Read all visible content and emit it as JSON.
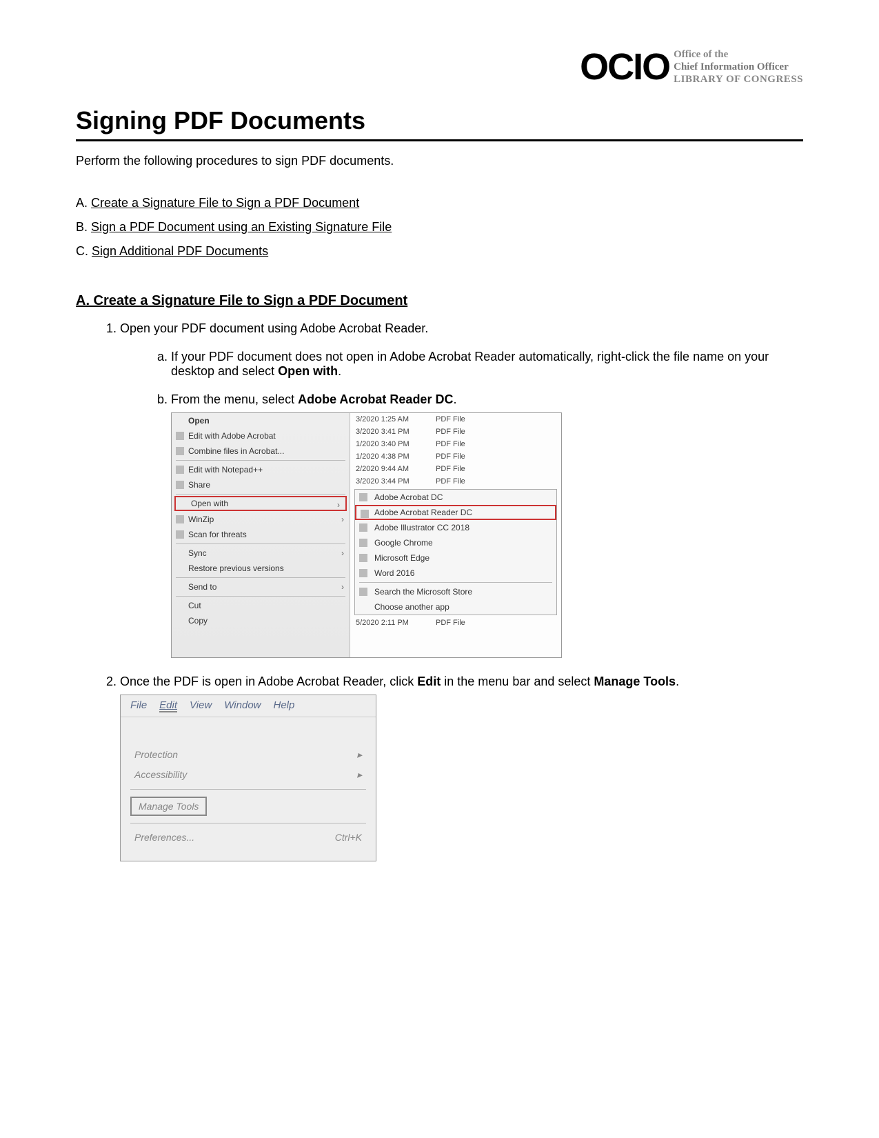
{
  "header": {
    "logo_text": "OCIO",
    "office_line1": "Office of the",
    "office_line2": "Chief Information Officer",
    "office_line3": "LIBRARY OF CONGRESS"
  },
  "title": "Signing PDF Documents",
  "intro": "Perform the following procedures to sign PDF documents.",
  "toc": {
    "a_prefix": "A. ",
    "a": "Create a Signature File to Sign a PDF Document",
    "b_prefix": "B. ",
    "b": "Sign a PDF Document using an Existing Signature File",
    "c_prefix": "C. ",
    "c": "Sign Additional PDF Documents"
  },
  "section_a": {
    "heading": "A. Create a Signature File to Sign a PDF Document",
    "step1": "Open your PDF document using Adobe Acrobat Reader.",
    "step1a_pre": "If your PDF document does not open in Adobe Acrobat Reader automatically, right-click the file name on your desktop and select ",
    "step1a_bold": "Open with",
    "step1a_post": ".",
    "step1b_pre": "From the menu, select ",
    "step1b_bold": "Adobe Acrobat Reader DC",
    "step1b_post": ".",
    "step2_pre": "Once the PDF is open in Adobe Acrobat Reader, click ",
    "step2_b1": "Edit",
    "step2_mid": " in the menu bar and select ",
    "step2_b2": "Manage Tools",
    "step2_post": "."
  },
  "screenshot1": {
    "ctx": {
      "open": "Open",
      "edit_acrobat": "Edit with Adobe Acrobat",
      "combine": "Combine files in Acrobat...",
      "edit_notepad": "Edit with Notepad++",
      "share": "Share",
      "open_with": "Open with",
      "winzip": "WinZip",
      "scan": "Scan for threats",
      "sync": "Sync",
      "restore": "Restore previous versions",
      "sendto": "Send to",
      "cut": "Cut",
      "copy": "Copy"
    },
    "files": [
      {
        "date": "3/2020 1:25 AM",
        "type": "PDF File"
      },
      {
        "date": "3/2020 3:41 PM",
        "type": "PDF File"
      },
      {
        "date": "1/2020 3:40 PM",
        "type": "PDF File"
      },
      {
        "date": "1/2020 4:38 PM",
        "type": "PDF File"
      },
      {
        "date": "2/2020 9:44 AM",
        "type": "PDF File"
      },
      {
        "date": "3/2020 3:44 PM",
        "type": "PDF File"
      }
    ],
    "submenu": {
      "acrobat_dc": "Adobe Acrobat DC",
      "reader_dc": "Adobe Acrobat Reader DC",
      "illustrator": "Adobe Illustrator CC 2018",
      "chrome": "Google Chrome",
      "edge": "Microsoft Edge",
      "word": "Word 2016",
      "store": "Search the Microsoft Store",
      "choose": "Choose another app"
    },
    "last_row": {
      "date": "5/2020 2:11 PM",
      "type": "PDF File"
    }
  },
  "screenshot2": {
    "menubar": {
      "file": "File",
      "edit": "Edit",
      "view": "View",
      "window": "Window",
      "help": "Help"
    },
    "items": {
      "protection": "Protection",
      "accessibility": "Accessibility",
      "manage_tools": "Manage Tools",
      "preferences": "Preferences...",
      "pref_shortcut": "Ctrl+K"
    },
    "arrow": "▸"
  }
}
